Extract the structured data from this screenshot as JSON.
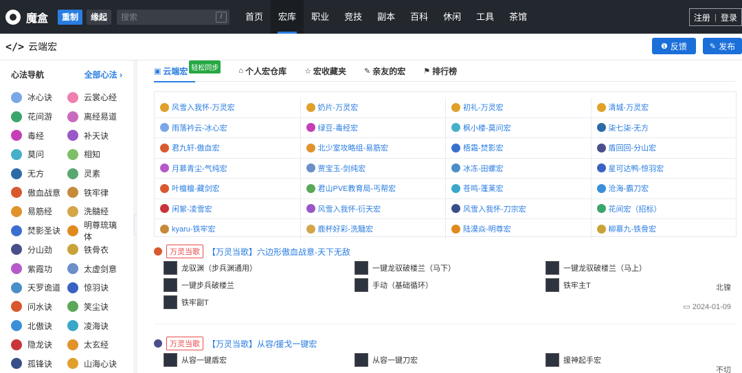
{
  "topbar": {
    "logo_text": "魔盒",
    "ver_active": "重制",
    "ver_plain": "缘起",
    "search_placeholder": "搜索",
    "search_shortcut": "/",
    "nav": [
      "首页",
      "宏库",
      "职业",
      "竞技",
      "副本",
      "百科",
      "休闲",
      "工具",
      "茶馆"
    ],
    "active_nav": "宏库",
    "register": "注册",
    "login": "登录"
  },
  "subheader": {
    "code_icon": "</>",
    "title": "云端宏",
    "feedback": "反馈",
    "publish": "发布"
  },
  "sidebar": {
    "title": "心法导航",
    "all": "全部心法 ›",
    "items": [
      {
        "label": "冰心诀",
        "color": "#7aa7e6"
      },
      {
        "label": "云裳心经",
        "color": "#f07fb0"
      },
      {
        "label": "花间游",
        "color": "#3aa66b"
      },
      {
        "label": "离经易道",
        "color": "#c96bbd"
      },
      {
        "label": "毒经",
        "color": "#c43fb5"
      },
      {
        "label": "补天诀",
        "color": "#9a57c8"
      },
      {
        "label": "莫问",
        "color": "#46b0c9"
      },
      {
        "label": "相知",
        "color": "#7fbf6a"
      },
      {
        "label": "无方",
        "color": "#2d6aa8"
      },
      {
        "label": "灵素",
        "color": "#58a86f"
      },
      {
        "label": "傲血战意",
        "color": "#d9592e"
      },
      {
        "label": "铁牢律",
        "color": "#c78a3a"
      },
      {
        "label": "易筋经",
        "color": "#e0932a"
      },
      {
        "label": "洗髓经",
        "color": "#d4a64a"
      },
      {
        "label": "焚影圣诀",
        "color": "#3b6fcf"
      },
      {
        "label": "明尊琉璃体",
        "color": "#e08a1e"
      },
      {
        "label": "分山劲",
        "color": "#4a4f8a"
      },
      {
        "label": "铁骨衣",
        "color": "#c9a23a"
      },
      {
        "label": "紫霞功",
        "color": "#b65ac9"
      },
      {
        "label": "太虚剑意",
        "color": "#6c8fc9"
      },
      {
        "label": "天罗诡道",
        "color": "#4a8fc9"
      },
      {
        "label": "惊羽诀",
        "color": "#3a62c4"
      },
      {
        "label": "问水诀",
        "color": "#d9572e"
      },
      {
        "label": "笑尘诀",
        "color": "#5aa858"
      },
      {
        "label": "北傲诀",
        "color": "#3a8fd9"
      },
      {
        "label": "凌海诀",
        "color": "#3aa6c9"
      },
      {
        "label": "隐龙诀",
        "color": "#c9333a"
      },
      {
        "label": "太玄经",
        "color": "#e0932a"
      },
      {
        "label": "孤锋诀",
        "color": "#3a4f8a"
      },
      {
        "label": "山海心诀",
        "color": "#e0a02a"
      }
    ]
  },
  "tabs": [
    {
      "label": "云端宏",
      "icon": "▣",
      "badge": "轻松同步",
      "active": true
    },
    {
      "label": "个人宏仓库",
      "icon": "⌂",
      "badge": "",
      "active": false
    },
    {
      "label": "宏收藏夹",
      "icon": "☆",
      "badge": "",
      "active": false
    },
    {
      "label": "亲友的宏",
      "icon": "✎",
      "badge": "",
      "active": false
    },
    {
      "label": "排行榜",
      "icon": "⚑",
      "badge": "",
      "active": false
    }
  ],
  "cloud_macros": [
    [
      {
        "t": "风雪入我怀-万灵宏",
        "c": "#e0a02a"
      },
      {
        "t": "奶片-万灵宏",
        "c": "#e0a02a"
      },
      {
        "t": "初礼-万灵宏",
        "c": "#e0a02a"
      },
      {
        "t": "清城-万灵宏",
        "c": "#e0a02a"
      }
    ],
    [
      {
        "t": "雨落衿云-冰心宏",
        "c": "#7aa7e6"
      },
      {
        "t": "绿豆-毒经宏",
        "c": "#c43fb5"
      },
      {
        "t": "枫小楼-莫问宏",
        "c": "#46b0c9"
      },
      {
        "t": "柒七柒-无方",
        "c": "#2d6aa8"
      }
    ],
    [
      {
        "t": "君九轩-傲血宏",
        "c": "#d9592e"
      },
      {
        "t": "北少室攻略组-易筋宏",
        "c": "#e0932a"
      },
      {
        "t": "梧霜-焚影宏",
        "c": "#3b6fcf"
      },
      {
        "t": "盾回回-分山宏",
        "c": "#4a4f8a"
      }
    ],
    [
      {
        "t": "月慕青尘-气纯宏",
        "c": "#b65ac9"
      },
      {
        "t": "贾宝玉-剑纯宏",
        "c": "#6c8fc9"
      },
      {
        "t": "冰冻-田螺宏",
        "c": "#4a8fc9"
      },
      {
        "t": "星可达鸭-惊羽宏",
        "c": "#3a62c4"
      }
    ],
    [
      {
        "t": "叶檀檀-藏剑宏",
        "c": "#d9572e"
      },
      {
        "t": "君山PVE教育局-丐帮宏",
        "c": "#5aa858"
      },
      {
        "t": "苍鸣-蓬莱宏",
        "c": "#3aa6c9"
      },
      {
        "t": "沧海-霸刀宏",
        "c": "#3a8fd9"
      }
    ],
    [
      {
        "t": "闲絮-凌雪宏",
        "c": "#c9333a"
      },
      {
        "t": "风雪入我怀-衍天宏",
        "c": "#9a57c8"
      },
      {
        "t": "风雪入我怀-刀宗宏",
        "c": "#3a4f8a"
      },
      {
        "t": "花间宏（招标）",
        "c": "#3aa66b"
      }
    ],
    [
      {
        "t": "kyaru-铁牢宏",
        "c": "#c78a3a"
      },
      {
        "t": "鹿杯好彩-洗髓宏",
        "c": "#d4a64a"
      },
      {
        "t": "陆漠焱-明尊宏",
        "c": "#e08a1e"
      },
      {
        "t": "柳慕九-铁骨宏",
        "c": "#c9a23a"
      }
    ]
  ],
  "posts": [
    {
      "xf_color": "#d9592e",
      "tag": "万灵当歌",
      "title": "【万灵当歌】六边形傲血战意-天下无敌",
      "macros": [
        "龙驭渊（步兵渊通用）",
        "一键龙驭破楼兰（马下）",
        "一键龙驭破楼兰（马上）",
        "一键步兵破楼兰",
        "手动（基础循环）",
        "铁牢主T",
        "铁牢副T"
      ],
      "author": "北镍",
      "date": "2024-01-09"
    },
    {
      "xf_color": "#4a4f8a",
      "tag": "万灵当歌",
      "title": "【万灵当歌】从容/援戈一键宏",
      "macros": [
        "从容一键盾宏",
        "从容一键刀宏",
        "援神起手宏"
      ],
      "author": "不切",
      "date": ""
    }
  ],
  "collapse_icon": "‹"
}
